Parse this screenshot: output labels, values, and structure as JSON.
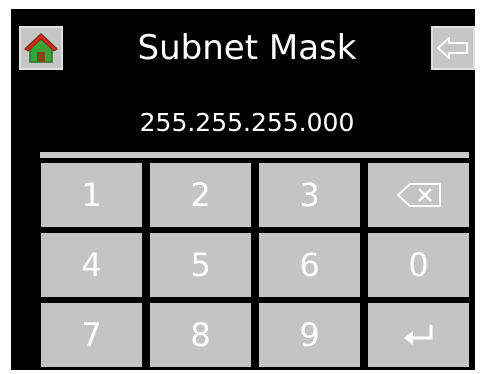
{
  "header": {
    "title": "Subnet Mask",
    "home_icon": "home-icon",
    "back_icon": "back-arrow-icon"
  },
  "display": {
    "value": "255.255.255.000"
  },
  "keypad": {
    "keys": [
      "1",
      "2",
      "3",
      "",
      "4",
      "5",
      "6",
      "0",
      "7",
      "8",
      "9",
      ""
    ],
    "backspace_icon": "backspace-icon",
    "enter_icon": "enter-icon"
  },
  "colors": {
    "background": "#000000",
    "key": "#c4c4c4",
    "key_text": "#ffffff",
    "home_roof": "#d62b1f",
    "home_body": "#3aa335"
  }
}
